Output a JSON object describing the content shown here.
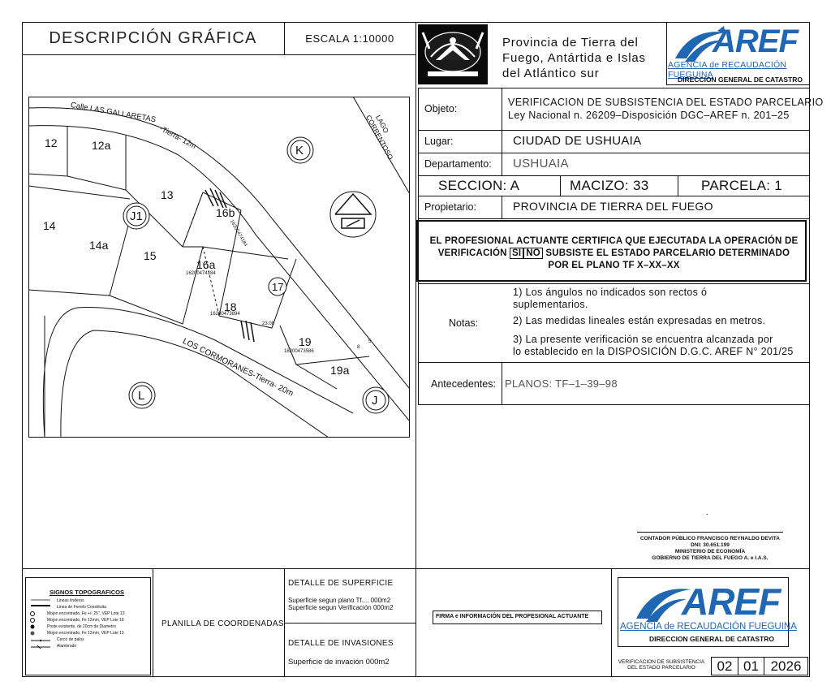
{
  "header": {
    "title": "DESCRIPCIÓN GRÁFICA",
    "scale": "ESCALA 1:10000",
    "province_lines": [
      "Provincia de Tierra del",
      "Fuego, Antártida e Islas",
      "del Atlántico sur"
    ],
    "aref_logo": "AREF",
    "aref_subtitle": "AGENCIA de RECAUDACIÓN FUEGUINA",
    "direction": "DIRECCION GENERAL DE CATASTRO"
  },
  "fields": {
    "objeto_label": "Objeto:",
    "objeto_line1": "VERIFICACION DE SUBSISTENCIA DEL ESTADO PARCELARIO",
    "objeto_line2": "Ley Nacional n. 26209–Disposición DGC–AREF n. 201–25",
    "lugar_label": "Lugar:",
    "lugar_value": "CIUDAD DE USHUAIA",
    "departamento_label": "Departamento:",
    "departamento_value": "USHUAIA",
    "seccion": "SECCION: A",
    "macizo": "MACIZO: 33",
    "parcela": "PARCELA: 1",
    "propietario_label": "Propietario:",
    "propietario_value": "PROVINCIA DE TIERRA DEL FUEGO"
  },
  "certification": {
    "line1": "EL PROFESIONAL ACTUANTE CERTIFICA QUE EJECUTADA LA OPERACIÓN DE",
    "line2_prefix": "VERIFICACIÓN",
    "si": "SI",
    "no": "NO",
    "line2_suffix": "SUBSISTE EL ESTADO PARCELARIO DETERMINADO",
    "line3": "POR EL PLANO TF X–XX–XX"
  },
  "notes": {
    "label": "Notas:",
    "note1_a": "1) Los ángulos no indicados son rectos ó",
    "note1_b": "suplementarios.",
    "note2": "2) Las medidas lineales están expresadas en metros.",
    "note3_a": "3) La presente verificación se encuentra alcanzada por",
    "note3_b": "lo establecido en la DISPOSICIÓN D.G.C. AREF N° 201/25"
  },
  "antecedentes": {
    "label": "Antecedentes:",
    "value": "PLANOS: TF–1–39–98"
  },
  "signature": {
    "dot": ".",
    "line1": "CONTADOR PÚBLICO FRANCISCO REYNALDO DEVITA",
    "line2": "DNI: 30.651.199",
    "line3": "MINISTERIO DE ECONOMÍA",
    "line4": "GOBIERNO DE TIERRA DEL FUEGO A. e I.A.S."
  },
  "bottom": {
    "signos_title": "SIGNOS TOPOGRAFICOS",
    "legend": [
      "Lineas linderos",
      "Linea de Fenelo Constituita",
      "Mojon encontrado, Fe +/- 25\", VEP Lote 13",
      "Mojon encontrado, Fe 12mm, VEP Lote 18",
      "Poste existente, de 20cm de Diametro",
      "Mojon encontrado, Fe 12mm, VEP Lote 13",
      "Cerco de palos",
      "Alambrado"
    ],
    "planilla": "PLANILLA DE COORDENADAS",
    "detalle_superficie": "DETALLE DE SUPERFICIE",
    "sup_plano": "Superficie segun plano Tf.... 000m2",
    "sup_verif": "Superficie segun Verificación 000m2",
    "detalle_invasiones": "DETALLE DE INVASIONES",
    "sup_invasion": "Superficie de invación 000m2",
    "firma": "FIRMA e INFORMACIÓN DEL PROFESIONAL ACTUANTE",
    "aref_logo": "AREF",
    "aref_subtitle": "AGENCIA de RECAUDACIÓN FUEGUINA",
    "direction": "DIRECCION GENERAL DE CATASTRO",
    "verif_line1": "VERIFICACION DE SUBSISTENCIA",
    "verif_line2": "DEL ESTADO PARCELARIO",
    "day": "02",
    "month": "01",
    "year": "2026"
  },
  "map": {
    "street_top": "Calle LAS GALLARETAS",
    "street_top_sub": "-Tierra- 12m",
    "lake": "LAGO",
    "lake2": "CORRENTOSO",
    "street_bottom": "LOS CORMORANES-Tierra- 20m",
    "circles": [
      "K",
      "J1",
      "L",
      "J"
    ],
    "lots": [
      "12",
      "12a",
      "13",
      "14",
      "14a",
      "15",
      "16a",
      "16b",
      "17",
      "18",
      "19",
      "19a"
    ],
    "nomenclatures": [
      "16200474184",
      "16200473894",
      "16200473586",
      "16200474184"
    ],
    "measures": [
      "23.08",
      "8",
      "5"
    ]
  },
  "colors": {
    "accent": "#1f66b3",
    "ink": "#111111"
  }
}
